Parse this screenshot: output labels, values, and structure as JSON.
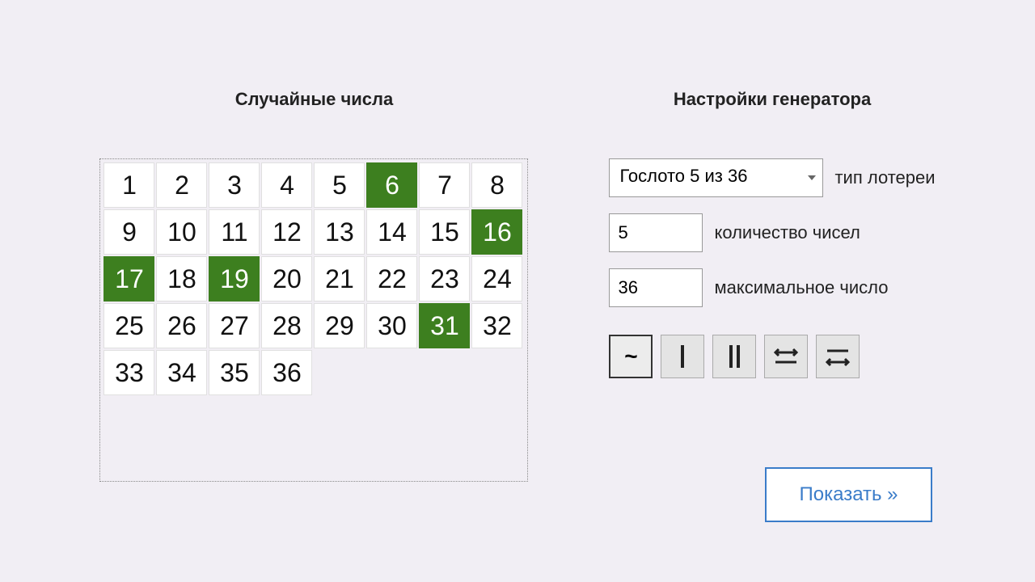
{
  "left": {
    "title": "Случайные числа",
    "grid": {
      "max": 36,
      "columns": 8,
      "selected": [
        6,
        16,
        17,
        19,
        31
      ]
    }
  },
  "right": {
    "title": "Настройки генератора",
    "lottery": {
      "selected": "Гослото 5 из 36",
      "label": "тип лотереи"
    },
    "count": {
      "value": "5",
      "label": "количество чисел"
    },
    "max": {
      "value": "36",
      "label": "максимальное число"
    },
    "modes": {
      "active": 0,
      "items": [
        "tilde",
        "single-bar",
        "double-bar",
        "arrow-over-line",
        "line-over-arrow"
      ]
    },
    "submit": "Показать »"
  }
}
